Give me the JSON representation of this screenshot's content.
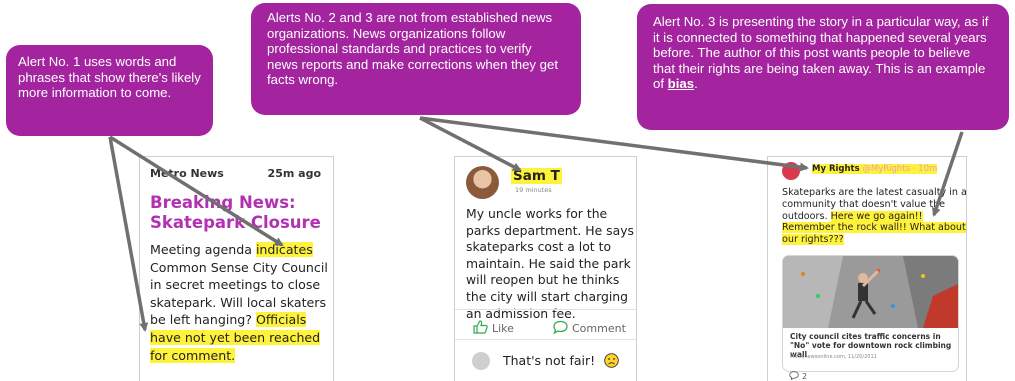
{
  "callouts": {
    "c1": "Alert No. 1 uses words and phrases that show there's likely more information to come.",
    "c2": "Alerts No. 2 and 3 are not from established news organizations. News organizations follow professional standards and practices to verify news reports and make corrections when they get facts wrong.",
    "c3_pre": "Alert No. 3 is presenting the story in a particular way, as if it is connected to something that happened several years before. The author of this post wants people to believe that their rights are being taken away. This is an example of ",
    "c3_term": "bias",
    "c3_post": "."
  },
  "card1": {
    "source": "Metro News",
    "time": "25m ago",
    "headline": "Breaking News: Skatepark Closure",
    "body_1": "Meeting agenda ",
    "body_hl1": "indicates",
    "body_2": " Common Sense City Council in secret meetings to close skatepark. Will local skaters be left hanging? ",
    "body_hl2": "Officials have not yet been reached for comment."
  },
  "card2": {
    "name": "Sam T",
    "minutes": "19 minutes",
    "body": "My uncle works for the parks department. He says skateparks cost a lot to maintain. He said the park will reopen but he thinks the city will start charging an admission fee.",
    "like": "Like",
    "comment": "Comment",
    "reply": "That's not fair!"
  },
  "card3": {
    "account": "My Rights",
    "handle": " @MyRights · 10m",
    "body_1": "Skateparks are the latest casualty in a community that doesn't value the outdoors. ",
    "body_hl": "Here we go again!! Remember the rock wall!! What about our rights???",
    "caption": "City council cites traffic concerns in \"No\" vote for downtown rock climbing wall",
    "link_source": "Metronewsonline.com, 11/20/2011",
    "reply_count": "2"
  },
  "colors": {
    "callout": "#a3249e",
    "headline": "#b132b1",
    "highlight": "#fff23a",
    "arrow": "#707070"
  }
}
